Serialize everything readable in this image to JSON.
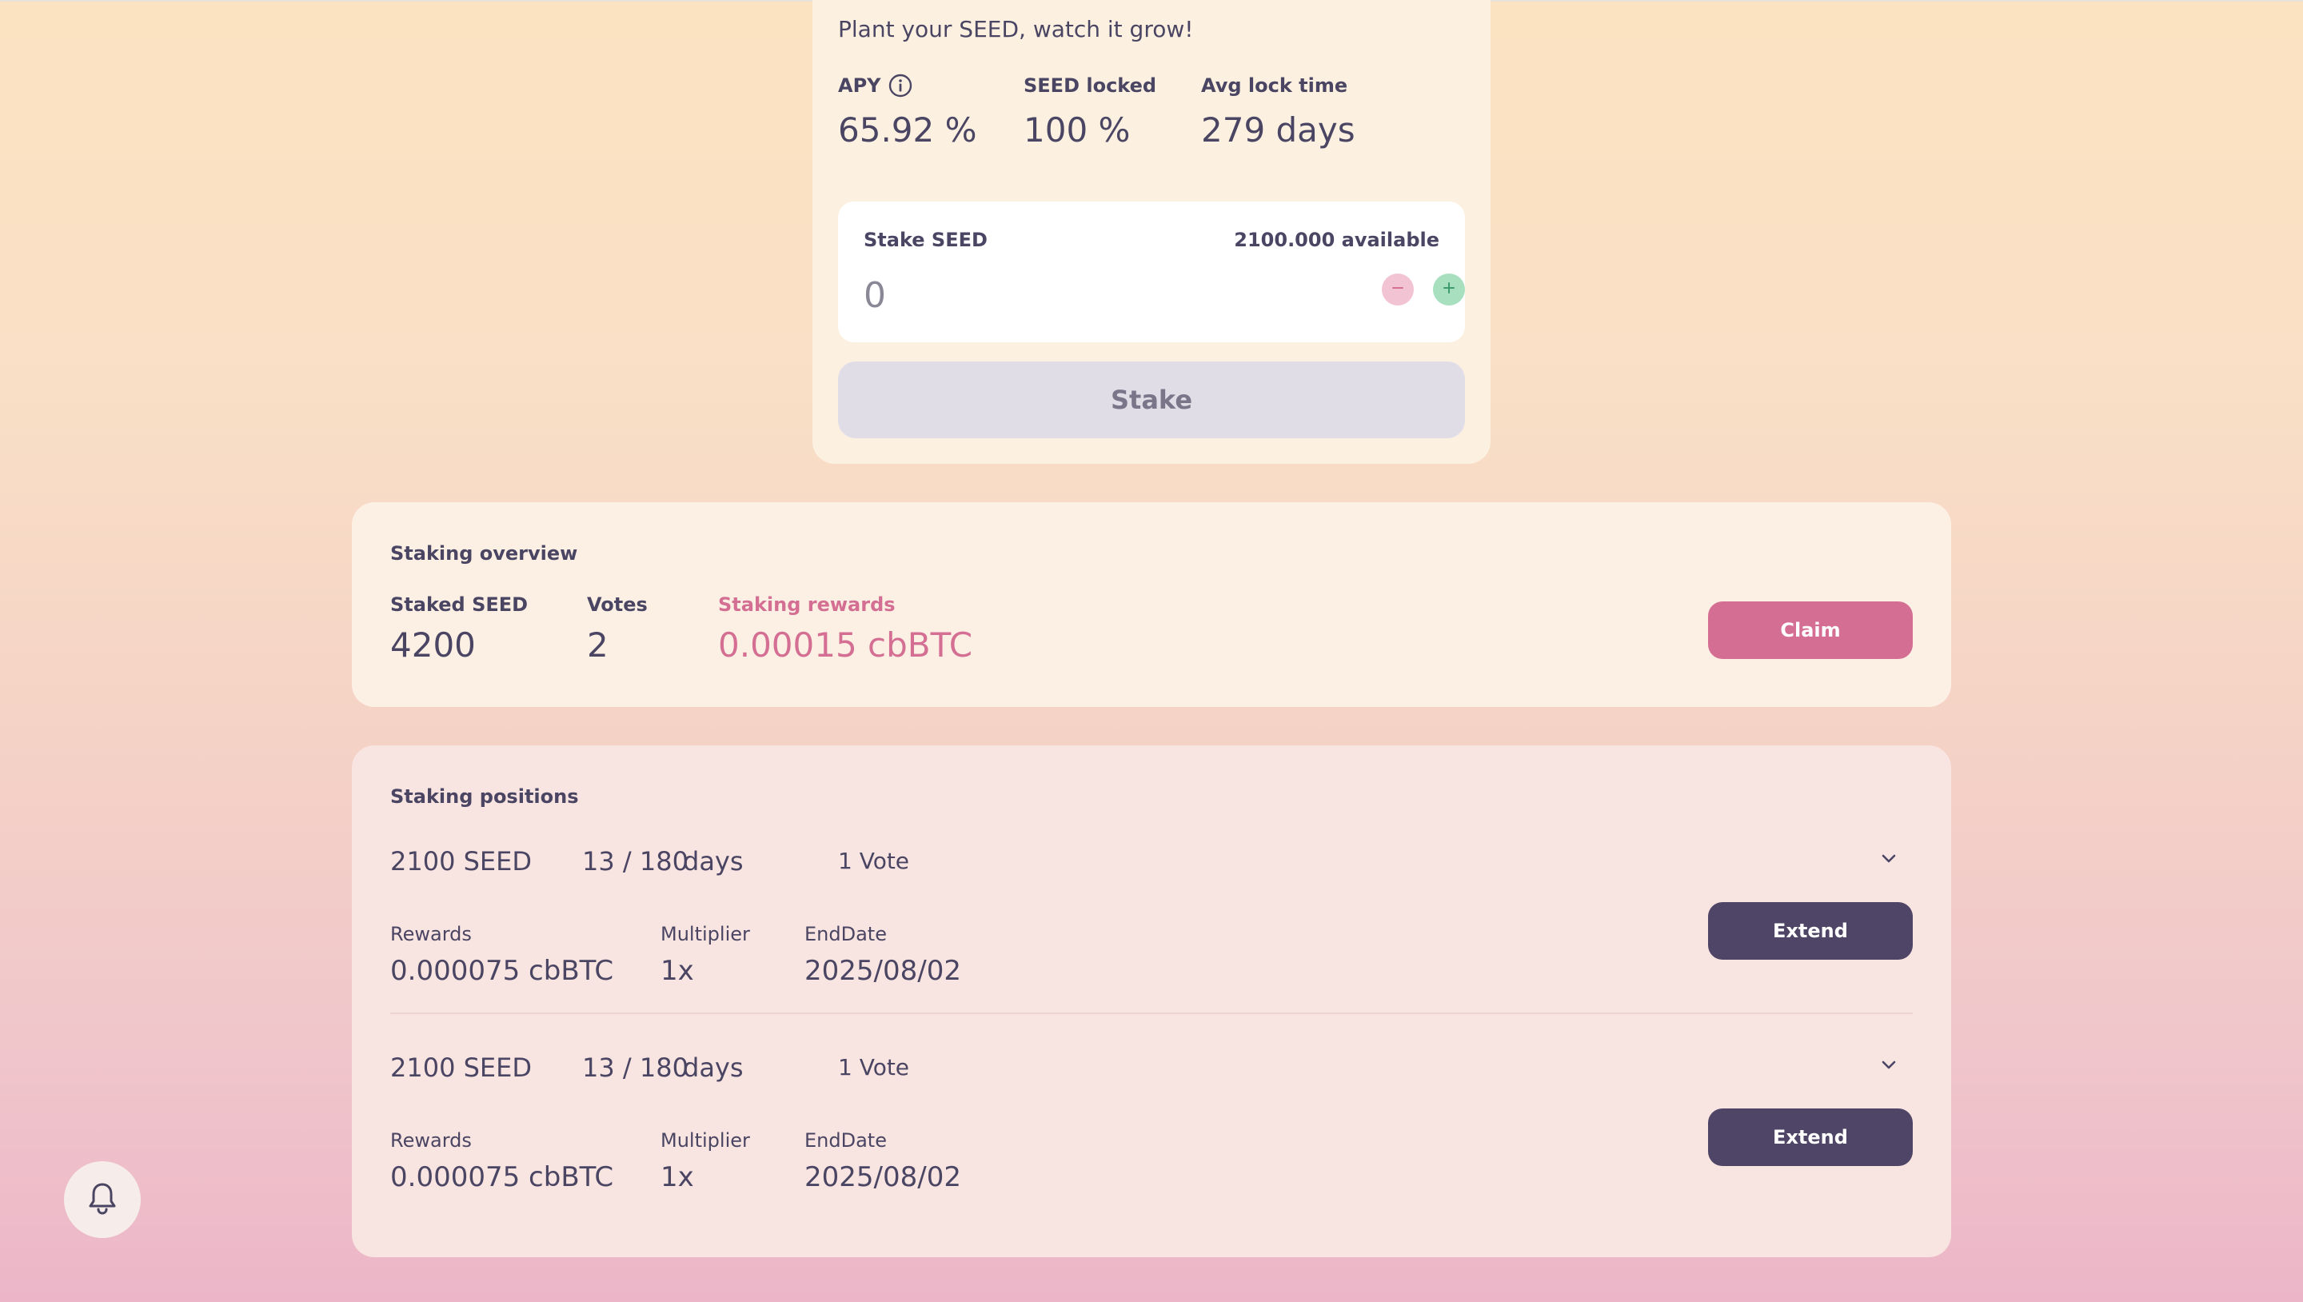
{
  "stake": {
    "tagline": "Plant your SEED, watch it grow!",
    "apy_label": "APY",
    "apy_value": "65.92 %",
    "locked_label": "SEED locked",
    "locked_value": "100 %",
    "avg_lock_label": "Avg lock time",
    "avg_lock_value": "279 days",
    "input_label": "Stake SEED",
    "available": "2100.000 available",
    "amount_value": "0",
    "button_label": "Stake"
  },
  "overview": {
    "title": "Staking overview",
    "staked_label": "Staked SEED",
    "staked_value": "4200",
    "votes_label": "Votes",
    "votes_value": "2",
    "rewards_label": "Staking rewards",
    "rewards_value": "0.00015 cbBTC",
    "claim_label": "Claim"
  },
  "positions": {
    "title": "Staking positions",
    "items": [
      {
        "amount": "2100 SEED",
        "progress": "13 / 180",
        "days_label": "days",
        "votes": "1 Vote",
        "rewards_label": "Rewards",
        "rewards_value": "0.000075 cbBTC",
        "multiplier_label": "Multiplier",
        "multiplier_value": "1x",
        "enddate_label": "EndDate",
        "enddate_value": "2025/08/02",
        "extend_label": "Extend"
      },
      {
        "amount": "2100 SEED",
        "progress": "13 / 180",
        "days_label": "days",
        "votes": "1 Vote",
        "rewards_label": "Rewards",
        "rewards_value": "0.000075 cbBTC",
        "multiplier_label": "Multiplier",
        "multiplier_value": "1x",
        "enddate_label": "EndDate",
        "enddate_value": "2025/08/02",
        "extend_label": "Extend"
      }
    ]
  },
  "icons": {
    "info": "info-icon",
    "minus": "minus-icon",
    "plus": "plus-icon",
    "chevron": "chevron-down-icon",
    "bell": "bell-icon"
  },
  "colors": {
    "accent_pink": "#d46f93",
    "dark_button": "#4f4566",
    "text": "#4a4563",
    "disabled_button": "#e1dde7"
  }
}
